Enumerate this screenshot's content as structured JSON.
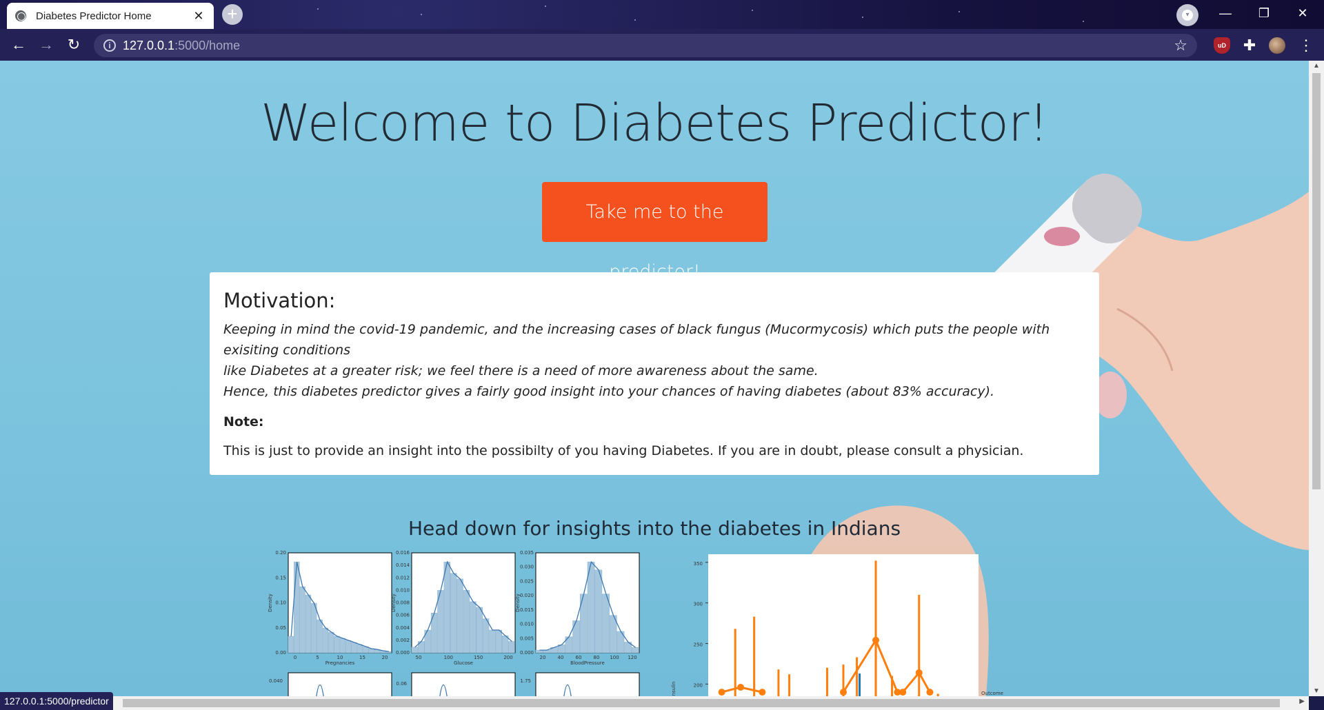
{
  "browser": {
    "tab_title": "Diabetes Predictor Home",
    "tab_close": "✕",
    "new_tab": "+",
    "url_host": "127.0.0.1",
    "url_path": ":5000/home",
    "status_url": "127.0.0.1:5000/predictor",
    "window_controls": {
      "minimize": "—",
      "restore": "❐",
      "close": "✕"
    },
    "nav": {
      "back": "←",
      "forward": "→",
      "reload": "↻"
    },
    "extensions": {
      "ublock": "uD",
      "puzzle": "✚",
      "menu": "⋮",
      "bookmark": "☆"
    }
  },
  "page": {
    "heading": "Welcome to Diabetes Predictor!",
    "cta_label": "Take me to the predictor!",
    "card": {
      "title": "Motivation:",
      "line1": "Keeping in mind the covid-19 pandemic, and the increasing cases of black fungus (Mucormycosis) which puts the people with exisiting conditions",
      "line2": "like Diabetes at a greater risk; we feel there is a need of more awareness about the same.",
      "line3": "Hence, this diabetes predictor gives a fairly good insight into your chances of having diabetes (about 83% accuracy).",
      "note_label": "Note:",
      "disclaimer": "This is just to provide an insight into the possibilty of you having Diabetes. If you are in doubt, please consult a physician."
    },
    "insights_heading": "Head down for insights into the diabetes in Indians"
  },
  "colors": {
    "cta": "#f4511e",
    "page_bg": "#7cc3de",
    "hist_bar": "#a6c6de",
    "kde_line": "#3c78b0",
    "orange": "#ff7f0e",
    "blue": "#1f77b4"
  },
  "chart_data": [
    {
      "type": "histogram",
      "xlabel": "Pregnancies",
      "ylabel": "Density",
      "x_ticks": [
        "0",
        "5",
        "10",
        "15",
        "20"
      ],
      "y_ticks": [
        "0.00",
        "0.05",
        "0.10",
        "0.15",
        "0.20"
      ],
      "bins": [
        0.04,
        0.22,
        0.16,
        0.14,
        0.12,
        0.08,
        0.06,
        0.05,
        0.04,
        0.035,
        0.03,
        0.025,
        0.02,
        0.015,
        0.01,
        0.008,
        0.005,
        0.003
      ]
    },
    {
      "type": "histogram",
      "xlabel": "Glucose",
      "ylabel": "Density",
      "x_ticks": [
        "50",
        "100",
        "150",
        "200"
      ],
      "y_ticks": [
        "0.000",
        "0.002",
        "0.004",
        "0.006",
        "0.008",
        "0.010",
        "0.012",
        "0.014",
        "0.016"
      ],
      "bins": [
        0.001,
        0.002,
        0.004,
        0.007,
        0.011,
        0.016,
        0.014,
        0.013,
        0.011,
        0.009,
        0.008,
        0.006,
        0.004,
        0.004,
        0.003,
        0.002
      ]
    },
    {
      "type": "histogram",
      "xlabel": "BloodPressure",
      "ylabel": "Density",
      "x_ticks": [
        "20",
        "40",
        "60",
        "80",
        "100",
        "120"
      ],
      "y_ticks": [
        "0.000",
        "0.005",
        "0.010",
        "0.015",
        "0.020",
        "0.025",
        "0.030",
        "0.035"
      ],
      "bins": [
        0.001,
        0.001,
        0.002,
        0.003,
        0.006,
        0.012,
        0.022,
        0.034,
        0.031,
        0.022,
        0.014,
        0.008,
        0.004,
        0.002
      ]
    },
    {
      "type": "line",
      "ylabel": "Insulin",
      "legend_title": "Outcome",
      "y_ticks": [
        "200",
        "250",
        "300",
        "350"
      ],
      "ylim": [
        185,
        360
      ],
      "series": [
        {
          "color": "#ff7f0e",
          "points": [
            [
              0.05,
              190
            ],
            [
              0.12,
              196
            ],
            [
              0.2,
              190
            ]
          ],
          "errorbars": [
            [
              0.1,
              185,
              268
            ],
            [
              0.17,
              185,
              283
            ],
            [
              0.26,
              185,
              218
            ],
            [
              0.3,
              185,
              212
            ],
            [
              0.44,
              185,
              220
            ],
            [
              0.55,
              185,
              233
            ],
            [
              0.5,
              185,
              224
            ],
            [
              0.62,
              185,
              255
            ],
            [
              0.78,
              185,
              310
            ],
            [
              0.85,
              185,
              188
            ]
          ]
        },
        {
          "color": "#ff7f0e",
          "points": [
            [
              0.5,
              190
            ],
            [
              0.62,
              254
            ],
            [
              0.7,
              190
            ]
          ],
          "errorbars": [
            [
              0.62,
              185,
              352
            ],
            [
              0.68,
              185,
              210
            ]
          ]
        },
        {
          "color": "#ff7f0e",
          "points": [
            [
              0.72,
              190
            ],
            [
              0.78,
              214
            ],
            [
              0.82,
              190
            ]
          ],
          "errorbars": []
        },
        {
          "color": "#1f77b4",
          "points": [],
          "errorbars": [
            [
              0.56,
              185,
              213
            ]
          ]
        }
      ]
    }
  ]
}
